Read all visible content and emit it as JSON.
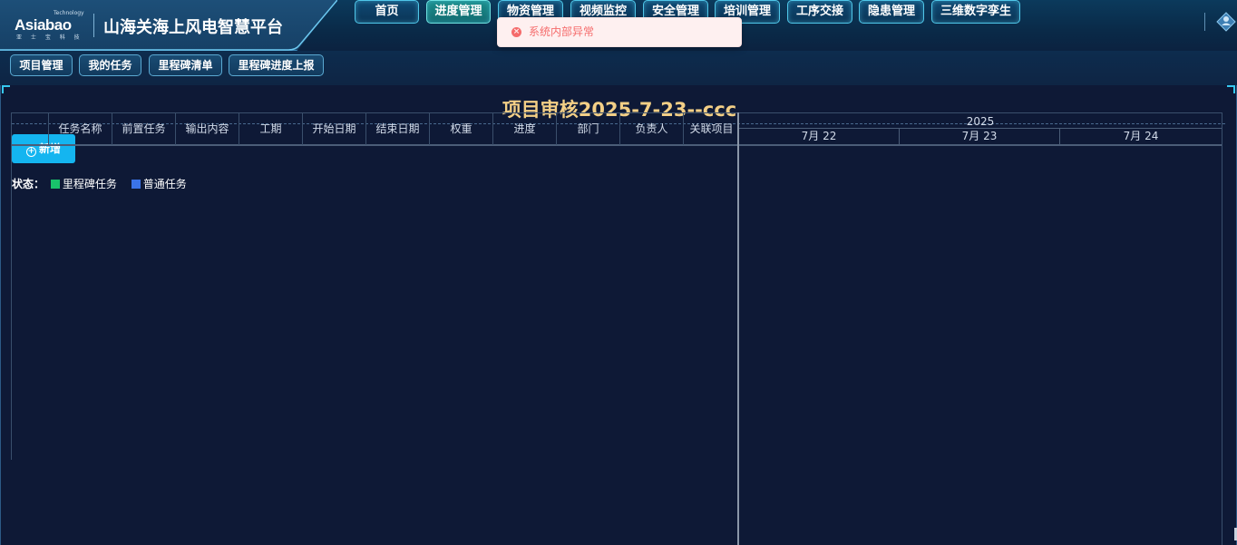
{
  "brand": {
    "logo_tm": "Technology",
    "logo_text": "Asiabao",
    "logo_sub": "亚 士 宝 科 技",
    "title": "山海关海上风电智慧平台"
  },
  "nav": [
    {
      "label": "首页",
      "active": false
    },
    {
      "label": "进度管理",
      "active": true
    },
    {
      "label": "物资管理",
      "active": false
    },
    {
      "label": "视频监控",
      "active": false
    },
    {
      "label": "安全管理",
      "active": false
    },
    {
      "label": "培训管理",
      "active": false
    },
    {
      "label": "工序交接",
      "active": false
    },
    {
      "label": "隐患管理",
      "active": false
    },
    {
      "label": "三维数字孪生",
      "active": false
    }
  ],
  "toast": {
    "message": "系统内部异常",
    "icon": "error-circle-icon"
  },
  "subnav": [
    "项目管理",
    "我的任务",
    "里程碑清单",
    "里程碑进度上报"
  ],
  "page": {
    "title": "项目审核2025-7-23--ccc",
    "add_button": "新增"
  },
  "legend": {
    "label": "状态：",
    "items": [
      {
        "label": "里程碑任务",
        "color": "#19c26b"
      },
      {
        "label": "普通任务",
        "color": "#3a73e8"
      }
    ]
  },
  "grid": {
    "columns": [
      "",
      "任务名称",
      "前置任务",
      "输出内容",
      "工期",
      "开始日期",
      "结束日期",
      "权重",
      "进度",
      "部门",
      "负责人",
      "关联项目"
    ]
  },
  "timeline": {
    "year": "2025",
    "days": [
      "7月 22",
      "7月 23",
      "7月 24"
    ]
  },
  "colors": {
    "accent": "#14b5f0",
    "title": "#f3cf86",
    "background": "#0e1936",
    "error": "#f56c6c"
  }
}
